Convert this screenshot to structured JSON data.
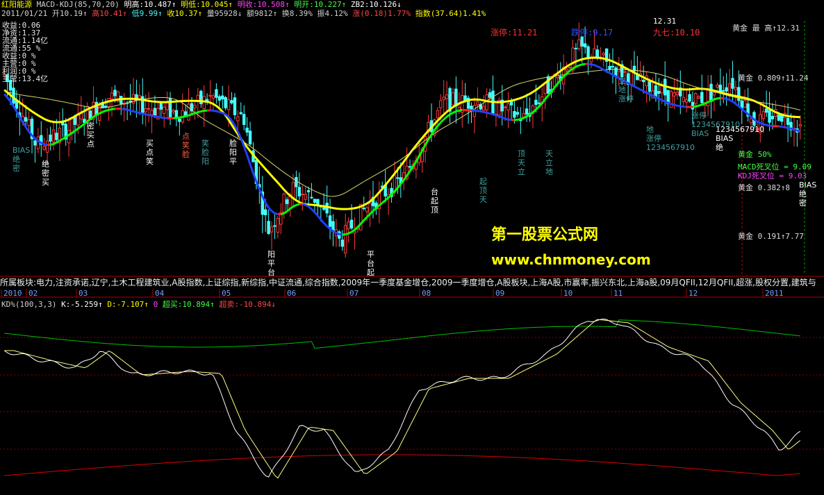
{
  "header": {
    "row1": [
      {
        "text": "红阳能源",
        "color": "#ffff00"
      },
      {
        "text": "MACD-KDJ(85,70,20)",
        "color": "#d0d0d0"
      },
      {
        "text": "明高:10.487↑",
        "color": "#ffffff"
      },
      {
        "text": "明低:10.045↑",
        "color": "#ffff00"
      },
      {
        "text": "明收:10.508↑",
        "color": "#ff44ff"
      },
      {
        "text": "明开:10.227↑",
        "color": "#44ff44"
      },
      {
        "text": "ZB2:10.126↓",
        "color": "#ffffff"
      }
    ],
    "row2": [
      {
        "text": "2011/01/21",
        "color": "#d0d0d0"
      },
      {
        "text": "开10.19↑",
        "color": "#d0d0d0"
      },
      {
        "text": "高10.41↑",
        "color": "#ff4444"
      },
      {
        "text": "低9.99↑",
        "color": "#44ffff"
      },
      {
        "text": "收10.37↑",
        "color": "#ffff00"
      },
      {
        "text": "量95928↓",
        "color": "#d0d0d0"
      },
      {
        "text": "额9812↑",
        "color": "#d0d0d0"
      },
      {
        "text": "换8.39%",
        "color": "#d0d0d0"
      },
      {
        "text": "振4.12%",
        "color": "#d0d0d0"
      },
      {
        "text": "涨(0.18)1.77%",
        "color": "#ff4444"
      },
      {
        "text": "指数(37.64)1.41%",
        "color": "#ffff00"
      }
    ]
  },
  "stats": [
    "收益:0.06",
    "净资:1.37",
    "流通:1.14亿",
    "流通:55 %",
    "收益:0 %",
    "主营:0 %",
    "利润:0 %",
    "主营:13.4亿"
  ],
  "annotations": {
    "limit_up": "涨停:11.21",
    "limit_down": "跌停:9.17",
    "jiuqi": "九七:10.10",
    "high_value": "12.31",
    "gold_labels": [
      "黄金 0.809↑11.24",
      "黄金 0.5↑",
      "黄金 0.382↑8",
      "黄金 0.191↑7.77"
    ],
    "gold_top": "黄金 最 高↑12.31",
    "macd_dead": "MACD死叉位 = 9.09",
    "kdj_dead": "KDJ死叉位 = 9.03",
    "gold_50": "黄金 50%",
    "small_marks": [
      "BIAS",
      "绝",
      "密",
      "买",
      "点",
      "笑",
      "脸",
      "阳",
      "平",
      "台",
      "起",
      "顶",
      "天",
      "立",
      "地",
      "涨停",
      "1234567910"
    ]
  },
  "board_text": "所属板块:电力,注资承诺,辽宁,土木工程建筑业,A股指数,上证综指,新综指,中证流通,综合指数,2009年一季度基金增仓,2009一季度增仓,A股板块,上海A股,市赢率,振兴东北,上海a股,09月QFII,12月QFII,超涨,股权分置,建筑与",
  "x_axis": {
    "months": [
      "2010",
      "02",
      "03",
      "04",
      "05",
      "06",
      "07",
      "08",
      "09",
      "10",
      "11",
      "12",
      "2011"
    ]
  },
  "kdj_header": [
    {
      "text": "KD%(100,3,3)",
      "color": "#d0d0d0"
    },
    {
      "text": "K:-5.259↑",
      "color": "#ffffff"
    },
    {
      "text": "D:-7.107↑",
      "color": "#ffff00"
    },
    {
      "text": "0",
      "color": "#ff44ff"
    },
    {
      "text": "超买:10.894↑",
      "color": "#44ff44"
    },
    {
      "text": "超卖:-10.894↓",
      "color": "#ff4444"
    }
  ],
  "watermark": {
    "name": "第一股票公式网",
    "url": "www.chnmoney.com"
  },
  "chart_data": {
    "type": "candlestick",
    "kdj_type": "line",
    "price_range": [
      7.5,
      12.5
    ],
    "overbought": 10.894,
    "oversold": -10.894,
    "colors": {
      "up": "#ff3b3b",
      "down": "#44ffff",
      "ma_yellow": "#ffff00",
      "ma_green": "#00ff00",
      "ma_red": "#ff2020",
      "ma_blue": "#2020ff"
    }
  }
}
